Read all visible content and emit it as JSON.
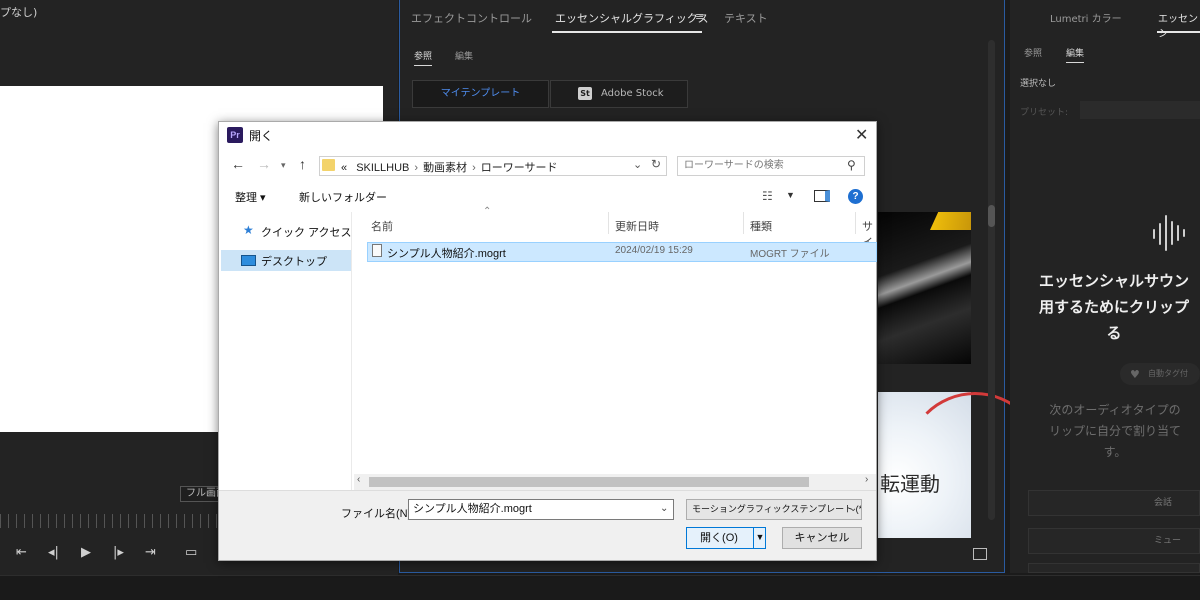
{
  "program": {
    "title": "プなし)",
    "fit_label": "フル画面",
    "transport_icons": [
      "go-to-in-icon",
      "step-back-icon",
      "play-icon",
      "step-forward-icon",
      "go-to-out-icon",
      "safe-margins-icon"
    ]
  },
  "center_panel": {
    "tabs": [
      "エフェクトコントロール",
      "エッセンシャルグラフィックス",
      "テキスト"
    ],
    "active_tab": "エッセンシャルグラフィックス",
    "subtabs": [
      "参照",
      "編集"
    ],
    "active_subtab": "参照",
    "segments": {
      "my_templates": "マイテンプレート",
      "stock_badge": "St",
      "stock": "Adobe Stock"
    },
    "thumbnail_text": "転運動",
    "accent_color": "#4f8df0"
  },
  "right_panel": {
    "tabs": [
      "Lumetri カラー",
      "エッセンシ"
    ],
    "subtabs": [
      "参照",
      "編集"
    ],
    "no_selection": "選択なし",
    "preset_label": "プリセット:",
    "message": "エッセンシャルサウン用するためにクリップる",
    "message_lines": [
      "エッセンシャルサウン",
      "用するためにクリップ",
      "る"
    ],
    "auto_tag": "自動タグ付",
    "audio_type_lines": [
      "次のオーディオタイプの",
      "リップに自分で割り当て",
      "す。"
    ],
    "buttons": [
      "会話",
      "ミュー"
    ]
  },
  "dialog": {
    "app_icon": "Pr",
    "title": "開く",
    "address": {
      "prefix": "«",
      "crumbs": [
        "SKILLHUB",
        "動画素材",
        "ローワーサード"
      ]
    },
    "search_placeholder": "ローワーサードの検索",
    "toolbar": {
      "organize": "整理 ▾",
      "new_folder": "新しいフォルダー"
    },
    "nav": {
      "quick_access": "クイック アクセス",
      "desktop": "デスクトップ"
    },
    "columns": {
      "name": "名前",
      "date": "更新日時",
      "type": "種類",
      "size": "サイ"
    },
    "files": [
      {
        "name": "シンプル人物紹介.mogrt",
        "date": "2024/02/19 15:29",
        "type": "MOGRT ファイル"
      }
    ],
    "filename_label": "ファイル名(N):",
    "filename_value": "シンプル人物紹介.mogrt",
    "filetype_value": "モーショングラフィックステンプレート (*",
    "open_label": "開く(O)",
    "cancel_label": "キャンセル",
    "help_label": "?"
  }
}
